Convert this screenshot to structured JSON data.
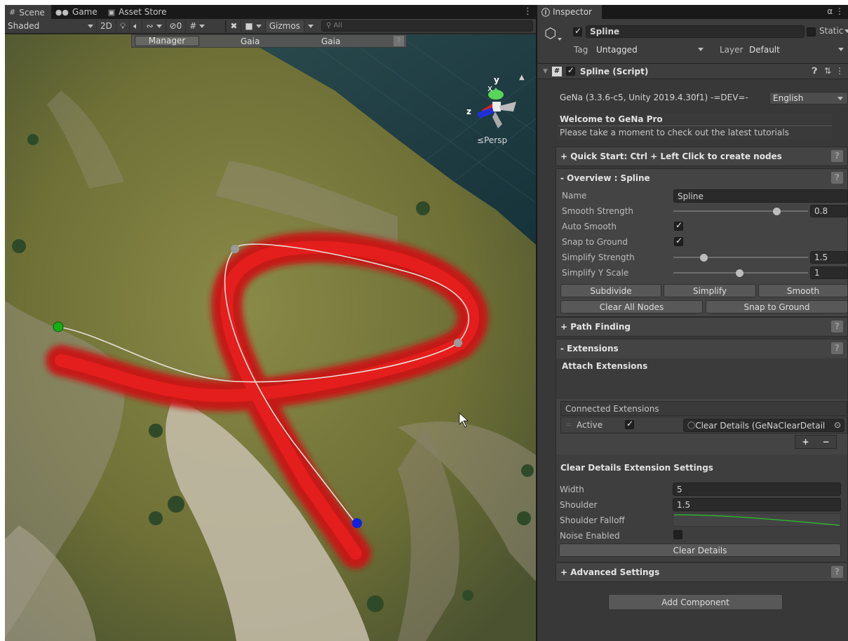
{
  "scene_tabs": [
    {
      "label": "Scene",
      "icon": "#"
    },
    {
      "label": "Game",
      "icon": "oo"
    },
    {
      "label": "Asset Store",
      "icon": "bag"
    }
  ],
  "toolbar": {
    "shading": "Shaded",
    "mode_2d": "2D",
    "hidden_count": "0",
    "gizmos": "Gizmos",
    "search_placeholder": "All"
  },
  "overlay_bar": {
    "manager": "Manager",
    "gaia_1": "Gaia",
    "gaia_2": "Gaia",
    "help": "?"
  },
  "orientation": {
    "x": "x",
    "y": "y",
    "z": "z",
    "persp": "Persp"
  },
  "inspector": {
    "tab": "Inspector",
    "object": {
      "name": "Spline",
      "static_label": "Static",
      "tag_label": "Tag",
      "tag_value": "Untagged",
      "layer_label": "Layer",
      "layer_value": "Default"
    },
    "component": {
      "title": "Spline (Script)"
    },
    "version": "GeNa (3.3.6-c5, Unity 2019.4.30f1) -=DEV=-",
    "language": "English",
    "welcome_title": "Welcome to GeNa Pro",
    "welcome_text": "Please take a moment to check out the latest tutorials",
    "quick_start": "+ Quick Start: Ctrl + Left Click to create nodes",
    "overview": {
      "title": "- Overview : Spline",
      "name_label": "Name",
      "name_value": "Spline",
      "smooth_strength_label": "Smooth Strength",
      "smooth_strength_value": "0.8",
      "auto_smooth_label": "Auto Smooth",
      "snap_label": "Snap to Ground",
      "simplify_strength_label": "Simplify Strength",
      "simplify_strength_value": "1.5",
      "simplify_y_label": "Simplify Y Scale",
      "simplify_y_value": "1",
      "btn_subdivide": "Subdivide",
      "btn_simplify": "Simplify",
      "btn_smooth": "Smooth",
      "btn_clear_all": "Clear All Nodes",
      "btn_snap": "Snap to Ground"
    },
    "path_finding": "+ Path Finding",
    "extensions": {
      "title": "- Extensions",
      "attach": "Attach Extensions",
      "connected": "Connected Extensions",
      "active_label": "Active",
      "extension_value": "Clear Details (GeNaClearDetail",
      "plus": "+",
      "minus": "−",
      "settings_title": "Clear Details Extension Settings",
      "width_label": "Width",
      "width_value": "5",
      "shoulder_label": "Shoulder",
      "shoulder_value": "1.5",
      "falloff_label": "Shoulder Falloff",
      "noise_label": "Noise Enabled",
      "btn_clear_details": "Clear Details"
    },
    "advanced": "+ Advanced Settings",
    "add_component": "Add Component",
    "help": "?"
  }
}
